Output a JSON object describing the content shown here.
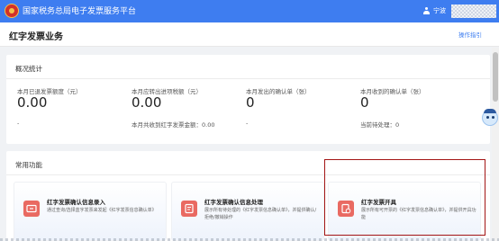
{
  "app": {
    "title": "国家税务总局电子发票服务平台"
  },
  "user": {
    "name": "宁波"
  },
  "header": {
    "title": "红字发票业务",
    "guide_link": "操作指引"
  },
  "overview": {
    "title": "概况统计",
    "stats": [
      {
        "label": "本月已退发票额度（元）",
        "value": "0.00",
        "sub": "-"
      },
      {
        "label": "本月应转出进项税额（元）",
        "value": "0.00",
        "sub": "本月共收到红字发票金额：0.00"
      },
      {
        "label": "本月发出的确认单（张）",
        "value": "0",
        "sub": "-"
      },
      {
        "label": "本月收到的确认单（张）",
        "value": "0",
        "sub": "当前待处理：0"
      }
    ]
  },
  "functions": {
    "title": "常用功能",
    "cards": [
      {
        "title": "红字发票确认信息录入",
        "desc": "通过查询/选择蓝字发票来发起《红字发票信息确认单》",
        "icon": "entry-icon"
      },
      {
        "title": "红字发票确认信息处理",
        "desc": "展示所有待处理的《红字发票信息确认单》，并提供确认/拒绝/撤销操作",
        "icon": "process-icon"
      },
      {
        "title": "红字发票开具",
        "desc": "展示所有可开票的《红字发票信息确认单》，并提供开具功能",
        "icon": "issue-icon"
      }
    ]
  },
  "colors": {
    "topbar": "#3e7df0",
    "card_icon": "#e96a62",
    "highlight": "#a31515"
  }
}
